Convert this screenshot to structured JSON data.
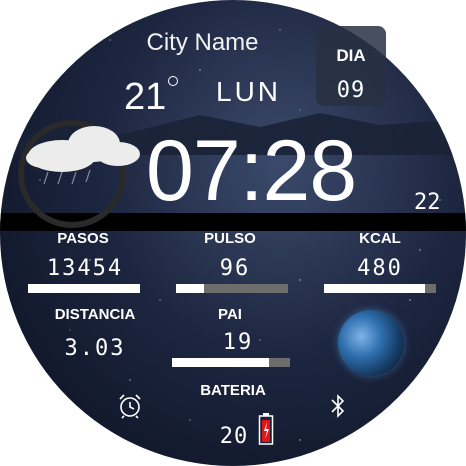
{
  "weather": {
    "city": "City Name",
    "temperature": "21",
    "icon": "cloud-rain-icon"
  },
  "date": {
    "day_name": "LUN",
    "day_label": "DIA",
    "day_number": "09"
  },
  "clock": {
    "time": "07:28",
    "seconds": "22"
  },
  "stats": {
    "steps": {
      "label": "PASOS",
      "value": "13454",
      "progress": 1.0
    },
    "pulse": {
      "label": "PULSO",
      "value": "96",
      "progress": 0.25
    },
    "kcal": {
      "label": "KCAL",
      "value": "480",
      "progress": 0.9
    },
    "distance": {
      "label": "DISTANCIA",
      "value": "3.03"
    },
    "pai": {
      "label": "PAI",
      "value": "19",
      "progress": 0.82
    }
  },
  "bottom": {
    "alarm_icon": "alarm-clock-icon",
    "bluetooth_icon": "bluetooth-icon",
    "battery_label": "BATERIA",
    "battery_value": "20",
    "battery_icon": "battery-low-icon"
  },
  "colors": {
    "bar_fill": "#ffffff",
    "bar_track": "#6d6d6d",
    "battery_red": "#e01515"
  }
}
